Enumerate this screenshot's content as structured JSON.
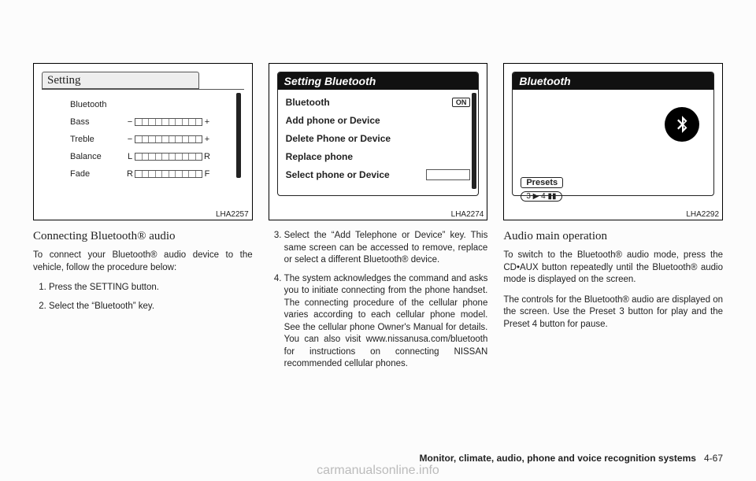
{
  "figure1": {
    "id": "LHA2257",
    "title": "Setting",
    "rows": [
      {
        "label": "Bluetooth",
        "left": "",
        "right": ""
      },
      {
        "label": "Bass",
        "left": "−",
        "right": "+"
      },
      {
        "label": "Treble",
        "left": "−",
        "right": "+"
      },
      {
        "label": "Balance",
        "left": "L",
        "right": "R"
      },
      {
        "label": "Fade",
        "left": "R",
        "right": "F"
      }
    ]
  },
  "figure2": {
    "id": "LHA2274",
    "title": "Setting Bluetooth",
    "on_label": "ON",
    "rows": [
      "Bluetooth",
      "Add phone or Device",
      "Delete Phone or Device",
      "Replace phone",
      "Select phone or Device"
    ]
  },
  "figure3": {
    "id": "LHA2292",
    "title": "Bluetooth",
    "presets_label": "Presets",
    "preset_text": "3 ▶  4 ▮▮"
  },
  "col1": {
    "heading": "Connecting Bluetooth® audio",
    "intro": "To connect your Bluetooth® audio device to the vehicle, follow the procedure below:",
    "step1": "Press the SETTING button.",
    "step2": "Select the “Bluetooth” key."
  },
  "col2": {
    "step3": "Select the “Add Telephone or Device” key. This same screen can be accessed to remove, replace or select a different Bluetooth® device.",
    "step4": "The system acknowledges the command and asks you to initiate connecting from the phone handset. The connecting procedure of the cellular phone varies according to each cellular phone model. See the cellular phone Owner's Manual for details. You can also visit www.nissanusa.com/bluetooth for instructions on connecting NISSAN recommended cellular phones."
  },
  "col3": {
    "heading": "Audio main operation",
    "p1": "To switch to the Bluetooth® audio mode, press the CD•AUX button repeatedly until the Bluetooth® audio mode is displayed on the screen.",
    "p2": "The controls for the Bluetooth® audio are displayed on the screen. Use the Preset 3 button for play and the Preset 4 button for pause."
  },
  "footer": {
    "section": "Monitor, climate, audio, phone and voice recognition systems",
    "page": "4-67"
  },
  "watermark": "carmanualsonline.info"
}
